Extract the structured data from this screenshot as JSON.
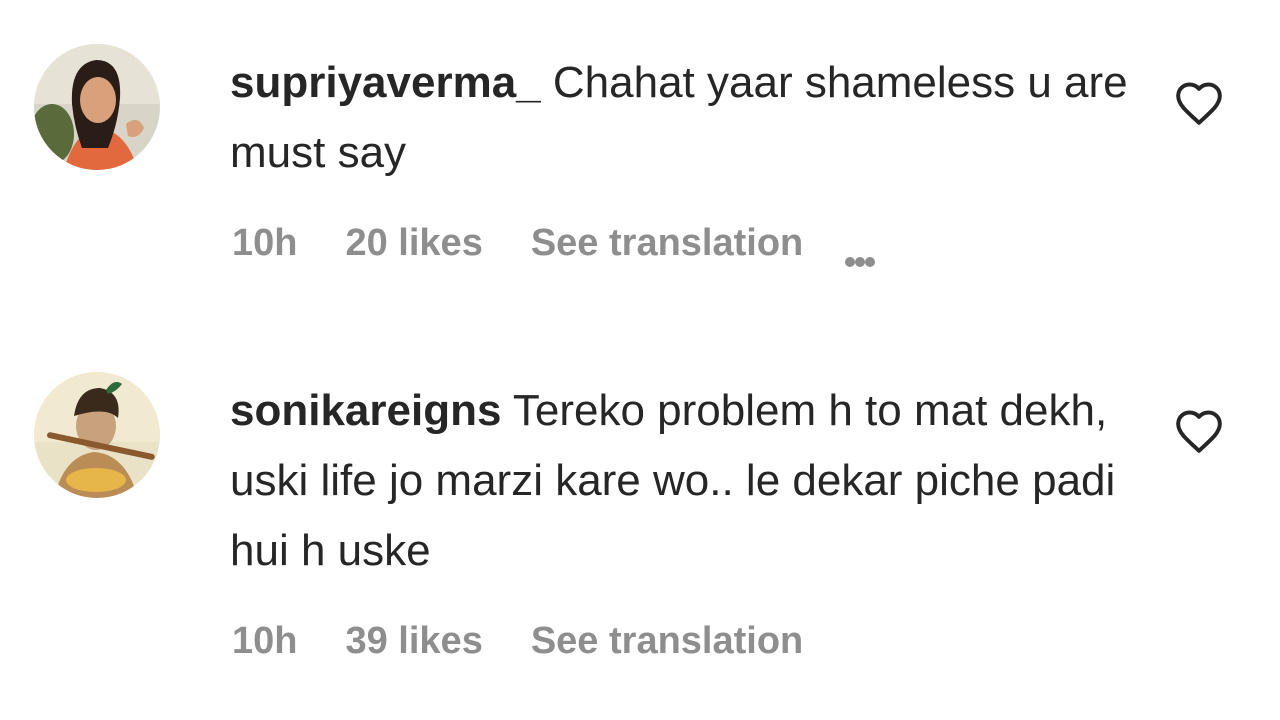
{
  "comments": [
    {
      "username": "supriyaverma_",
      "text": "Chahat yaar shameless u are must say",
      "time": "10h",
      "likes": "20 likes",
      "translate": "See translation",
      "more_icon": "ellipsis-icon",
      "like_icon": "heart-outline-icon"
    },
    {
      "username": "sonikareigns",
      "text": "Tereko problem h to mat dekh, uski life jo marzi kare wo.. le dekar piche padi hui h uske",
      "time": "10h",
      "likes": "39 likes",
      "translate": "See translation",
      "like_icon": "heart-outline-icon"
    }
  ]
}
